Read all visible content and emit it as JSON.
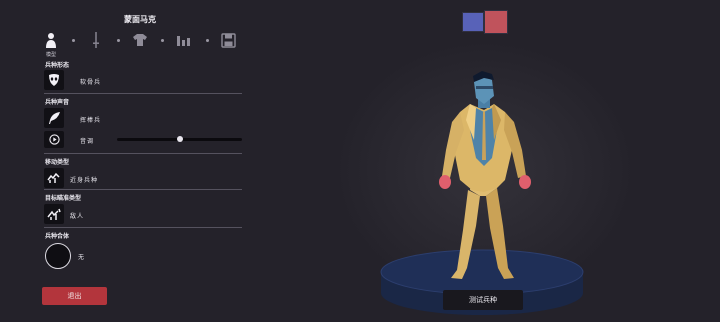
{
  "panel": {
    "title": "蒙面马克",
    "step_caption": "模型",
    "steps": [
      "model-icon",
      "weapon-icon",
      "armor-icon",
      "stats-icon",
      "save-icon"
    ]
  },
  "sections": {
    "form": {
      "label": "兵种形态",
      "value": "软骨兵",
      "icon": "mask-icon"
    },
    "voice": {
      "label": "兵种声音",
      "value": "挥棒兵",
      "icon": "feather-icon",
      "pitch_label": "音调",
      "pitch_level": 0.5
    },
    "movement": {
      "label": "移动类型",
      "value": "近身兵种",
      "icon": "movement-icon"
    },
    "targeting": {
      "label": "目标瞄准类型",
      "value": "敌人",
      "icon": "target-icon"
    },
    "combine": {
      "label": "兵种合体",
      "value": "无"
    }
  },
  "buttons": {
    "exit": "退出",
    "test": "测试兵种"
  },
  "team_colors": [
    {
      "name": "blue-team",
      "color": "#5862b8"
    },
    {
      "name": "red-team",
      "color": "#c0535c"
    }
  ],
  "colors": {
    "background": "#24222a",
    "exit": "#b3353c"
  }
}
